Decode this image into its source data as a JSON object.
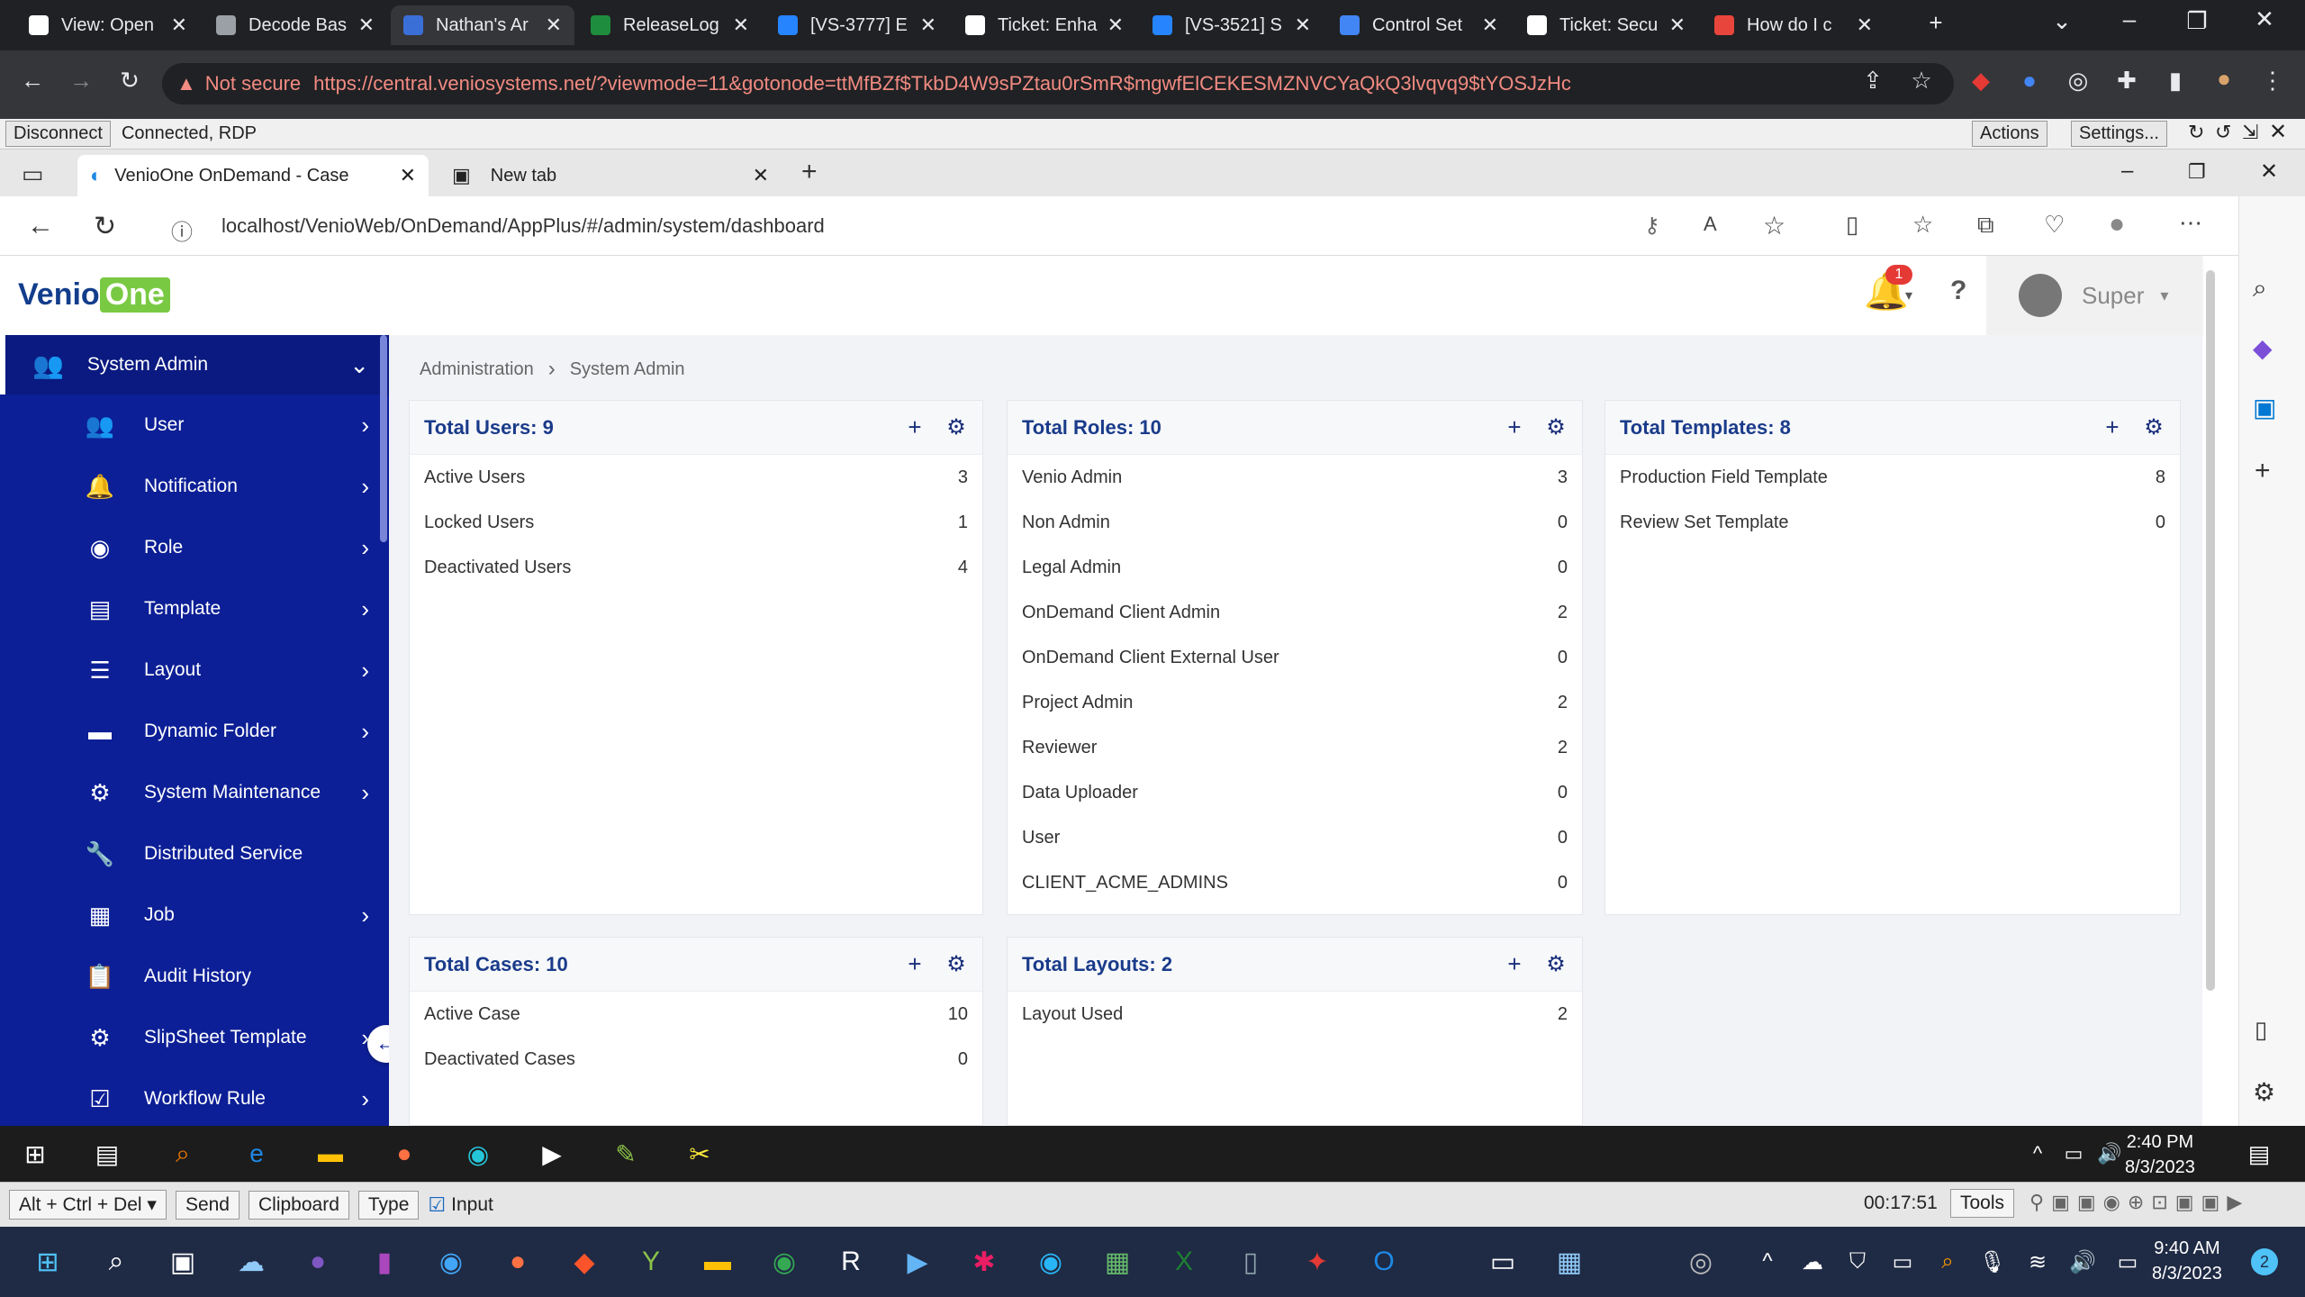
{
  "outer_browser": {
    "tabs": [
      {
        "title": "View: Open",
        "color": "#ffffff"
      },
      {
        "title": "Decode Bas",
        "color": "#9aa0a6"
      },
      {
        "title": "Nathan's Ar",
        "color": "#3b6fd8"
      },
      {
        "title": "ReleaseLog",
        "color": "#1e8e3e"
      },
      {
        "title": "[VS-3777] E",
        "color": "#2684ff"
      },
      {
        "title": "Ticket: Enha",
        "color": "#ffffff"
      },
      {
        "title": "[VS-3521] S",
        "color": "#2684ff"
      },
      {
        "title": "Control Set",
        "color": "#4285f4"
      },
      {
        "title": "Ticket: Secu",
        "color": "#ffffff"
      },
      {
        "title": "How do I c",
        "color": "#e8453c"
      }
    ],
    "new_tab": "+",
    "not_secure": "Not secure",
    "url": "https://central.veniosystems.net/?viewmode=11&gotonode=ttMfBZf$TkbD4W9sPZtau0rSmR$mgwfElCEKESMZNVCYaQkQ3lvqvq9$tYOSJzHc"
  },
  "rdp": {
    "disconnect": "Disconnect",
    "status": "Connected, RDP",
    "actions": "Actions",
    "settings": "Settings..."
  },
  "inner_browser": {
    "tabs": [
      {
        "title": "VenioOne OnDemand - Case"
      },
      {
        "title": "New tab"
      }
    ],
    "url": "localhost/VenioWeb/OnDemand/AppPlus/#/admin/system/dashboard"
  },
  "app": {
    "logo_venio": "Venio",
    "logo_one": "One",
    "notification_count": "1",
    "help": "?",
    "user_name": "Super",
    "sidebar": {
      "header": "System Admin",
      "items": [
        {
          "label": "User",
          "icon": "user-plus-icon",
          "glyph": "👥",
          "chevron": true
        },
        {
          "label": "Notification",
          "icon": "bell-icon",
          "glyph": "🔔",
          "chevron": true
        },
        {
          "label": "Role",
          "icon": "user-circle-icon",
          "glyph": "◉",
          "chevron": true
        },
        {
          "label": "Template",
          "icon": "template-icon",
          "glyph": "▤",
          "chevron": true
        },
        {
          "label": "Layout",
          "icon": "sliders-icon",
          "glyph": "☰",
          "chevron": true
        },
        {
          "label": "Dynamic Folder",
          "icon": "folder-icon",
          "glyph": "▬",
          "chevron": true
        },
        {
          "label": "System Maintenance",
          "icon": "gear-icon",
          "glyph": "⚙",
          "chevron": true
        },
        {
          "label": "Distributed Service",
          "icon": "wrench-icon",
          "glyph": "🔧",
          "chevron": false
        },
        {
          "label": "Job",
          "icon": "grid-icon",
          "glyph": "▦",
          "chevron": true
        },
        {
          "label": "Audit History",
          "icon": "clipboard-icon",
          "glyph": "📋",
          "chevron": false
        },
        {
          "label": "SlipSheet Template",
          "icon": "slipsheet-icon",
          "glyph": "⚙",
          "chevron": true
        },
        {
          "label": "Workflow Rule",
          "icon": "check-clipboard-icon",
          "glyph": "☑",
          "chevron": true
        }
      ]
    },
    "breadcrumb": {
      "parent": "Administration",
      "sep": "›",
      "current": "System Admin"
    },
    "cards": {
      "users": {
        "title": "Total Users: 9",
        "rows": [
          {
            "label": "Active Users",
            "value": "3"
          },
          {
            "label": "Locked Users",
            "value": "1"
          },
          {
            "label": "Deactivated Users",
            "value": "4"
          }
        ]
      },
      "roles": {
        "title": "Total Roles: 10",
        "rows": [
          {
            "label": "Venio Admin",
            "value": "3"
          },
          {
            "label": "Non Admin",
            "value": "0"
          },
          {
            "label": "Legal Admin",
            "value": "0"
          },
          {
            "label": "OnDemand Client Admin",
            "value": "2"
          },
          {
            "label": "OnDemand Client External User",
            "value": "0"
          },
          {
            "label": "Project Admin",
            "value": "2"
          },
          {
            "label": "Reviewer",
            "value": "2"
          },
          {
            "label": "Data Uploader",
            "value": "0"
          },
          {
            "label": "User",
            "value": "0"
          },
          {
            "label": "CLIENT_ACME_ADMINS",
            "value": "0"
          }
        ]
      },
      "templates": {
        "title": "Total Templates: 8",
        "rows": [
          {
            "label": "Production Field Template",
            "value": "8"
          },
          {
            "label": "Review Set Template",
            "value": "0"
          }
        ]
      },
      "cases": {
        "title": "Total Cases: 10",
        "rows": [
          {
            "label": "Active Case",
            "value": "10"
          },
          {
            "label": "Deactivated Cases",
            "value": "0"
          }
        ]
      },
      "layouts": {
        "title": "Total Layouts: 2",
        "rows": [
          {
            "label": "Layout Used",
            "value": "2"
          }
        ]
      }
    }
  },
  "remote_taskbar": {
    "time": "2:40 PM",
    "date": "8/3/2023"
  },
  "rdp_bottom": {
    "keys": "Alt + Ctrl + Del",
    "send": "Send",
    "clipboard": "Clipboard",
    "type": "Type",
    "input": "Input",
    "timer": "00:17:51",
    "tools": "Tools"
  },
  "host_taskbar": {
    "time": "9:40 AM",
    "date": "8/3/2023",
    "badge": "2"
  }
}
